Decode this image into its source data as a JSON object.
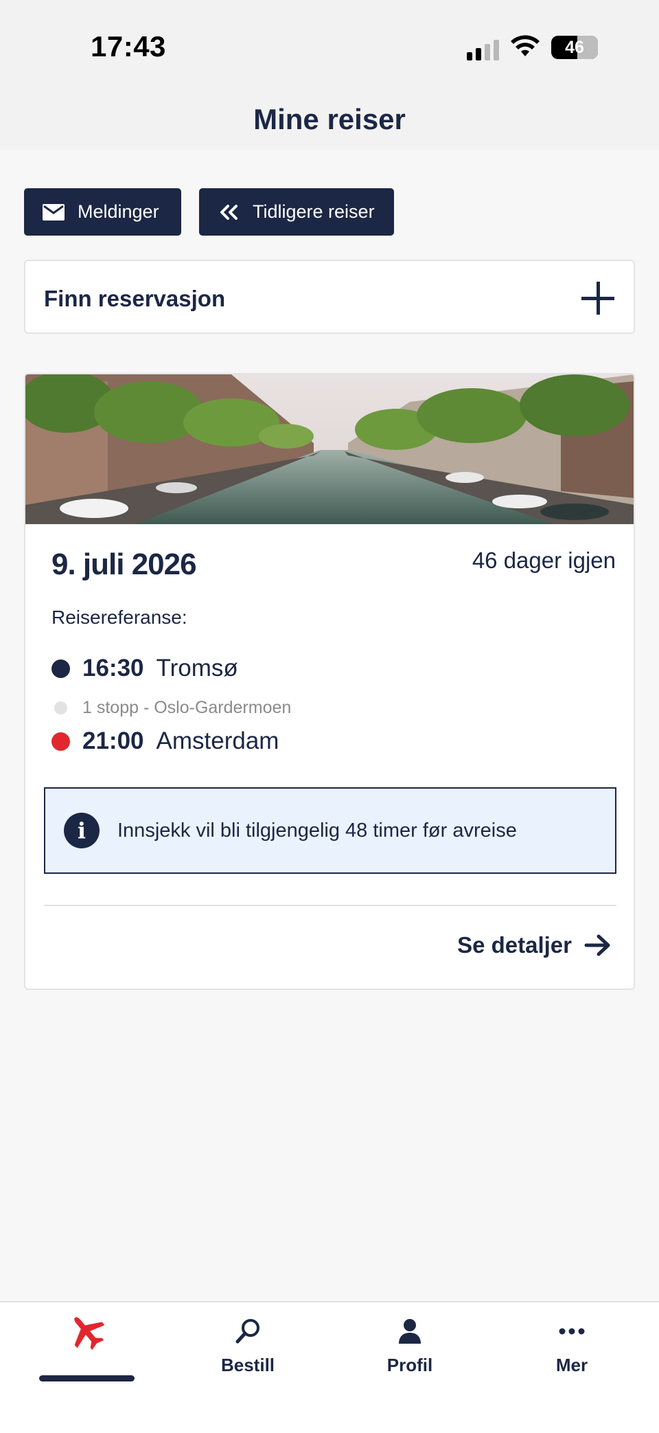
{
  "status_bar": {
    "time": "17:43",
    "battery": "46"
  },
  "header": {
    "title": "Mine reiser"
  },
  "actions": {
    "messages_label": "Meldinger",
    "previous_trips_label": "Tidligere reiser"
  },
  "find_reservation": {
    "label": "Finn reservasjon"
  },
  "trip": {
    "date": "9. juli 2026",
    "days_left": "46 dager igjen",
    "reference_label": "Reisereferanse:",
    "departure": {
      "time": "16:30",
      "city": "Tromsø"
    },
    "stops": "1 stopp - Oslo-Gardermoen",
    "arrival": {
      "time": "21:00",
      "city": "Amsterdam"
    },
    "info": "Innsjekk vil bli tilgjengelig 48 timer før avreise",
    "details_label": "Se detaljer"
  },
  "tabbar": {
    "items": [
      {
        "label": "",
        "icon": "airplane-icon",
        "active": true
      },
      {
        "label": "Bestill",
        "icon": "search-icon"
      },
      {
        "label": "Profil",
        "icon": "person-icon"
      },
      {
        "label": "Mer",
        "icon": "more-icon"
      }
    ]
  },
  "colors": {
    "navy": "#1c2745",
    "red": "#e1272d",
    "info_bg": "#eaf2fd",
    "page_bg": "#f7f7f7"
  }
}
